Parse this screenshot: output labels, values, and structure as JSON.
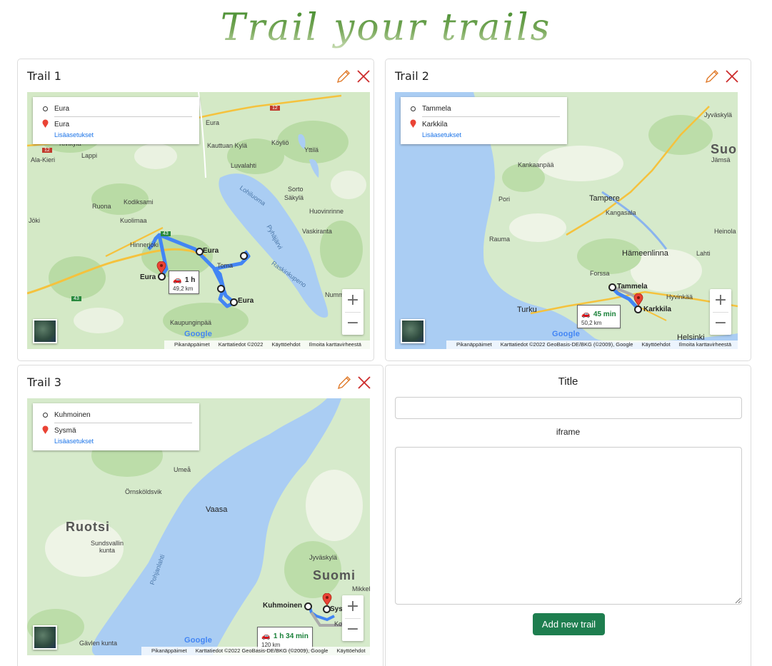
{
  "header": {
    "title": "Trail your trails"
  },
  "map_ui": {
    "more_options": "Lisäasetukset",
    "zoom_in": "+",
    "zoom_out": "−",
    "google": "Google",
    "shortcuts": "Pikanäppäimet",
    "map_data_short": "Karttatiedot ©2022",
    "map_data_long": "Karttatiedot ©2022 GeoBasis-DE/BKG (©2009), Google",
    "terms": "Käyttöehdot",
    "report": "Ilmoita karttavirheestä"
  },
  "trails": [
    {
      "title": "Trail 1",
      "origin": "Eura",
      "destination": "Eura",
      "duration": "1 h",
      "distance": "49,2 km",
      "places": [
        "Eura",
        "Kauttuan Kylä",
        "Köyliö",
        "Yttilä",
        "Luvalahti",
        "Säkylä",
        "Sorto",
        "Huovinrinne",
        "Vaskiranta",
        "Kodiksami",
        "Ruona",
        "Kuolimaa",
        "Hinnerjoki",
        "Lappi",
        "Ala-Kieri",
        "Kivikylä",
        "Kaupunginpää",
        "Toma",
        "Eura",
        "Eura",
        "Eura",
        "Numm",
        "Jöki"
      ],
      "lakes": [
        "Lohiluoma",
        "Pyhäjärvi",
        "Raskinkupeno"
      ],
      "roads": [
        "12",
        "12",
        "12",
        "43",
        "43"
      ]
    },
    {
      "title": "Trail 2",
      "origin": "Tammela",
      "destination": "Karkkila",
      "duration": "45 min",
      "distance": "50,2 km",
      "places": [
        "Suo",
        "Jyväskylä",
        "Jämsä",
        "Kankaanpää",
        "Pori",
        "Tampere",
        "Kangasala",
        "Rauma",
        "Hämeenlinna",
        "Lahti",
        "Heinola",
        "Forssa",
        "Turku",
        "Hyvinkää",
        "Helsinki",
        "Tammela",
        "Karkkila"
      ]
    },
    {
      "title": "Trail 3",
      "origin": "Kuhmoinen",
      "destination": "Sysmä",
      "duration": "1 h 34 min",
      "distance": "120 km",
      "places": [
        "Ruotsi",
        "Suomi",
        "Sundsvallin kunta",
        "Örnsköldsvik",
        "Umeå",
        "Vaasa",
        "Jyväskylä",
        "Mikkeli",
        "Kuhmoinen",
        "Sys",
        "Ko",
        "Gävlen kunta",
        "Pohjanlahti"
      ]
    }
  ],
  "form": {
    "title_label": "Title",
    "title_value": "",
    "iframe_label": "iframe",
    "iframe_value": "",
    "submit_label": "Add new trail"
  },
  "colors": {
    "title_green": "#4a8b35",
    "edit_orange": "#e07a2a",
    "delete_red": "#cc2b2b",
    "route_blue": "#4285f4",
    "button_green": "#1e7e4f"
  }
}
